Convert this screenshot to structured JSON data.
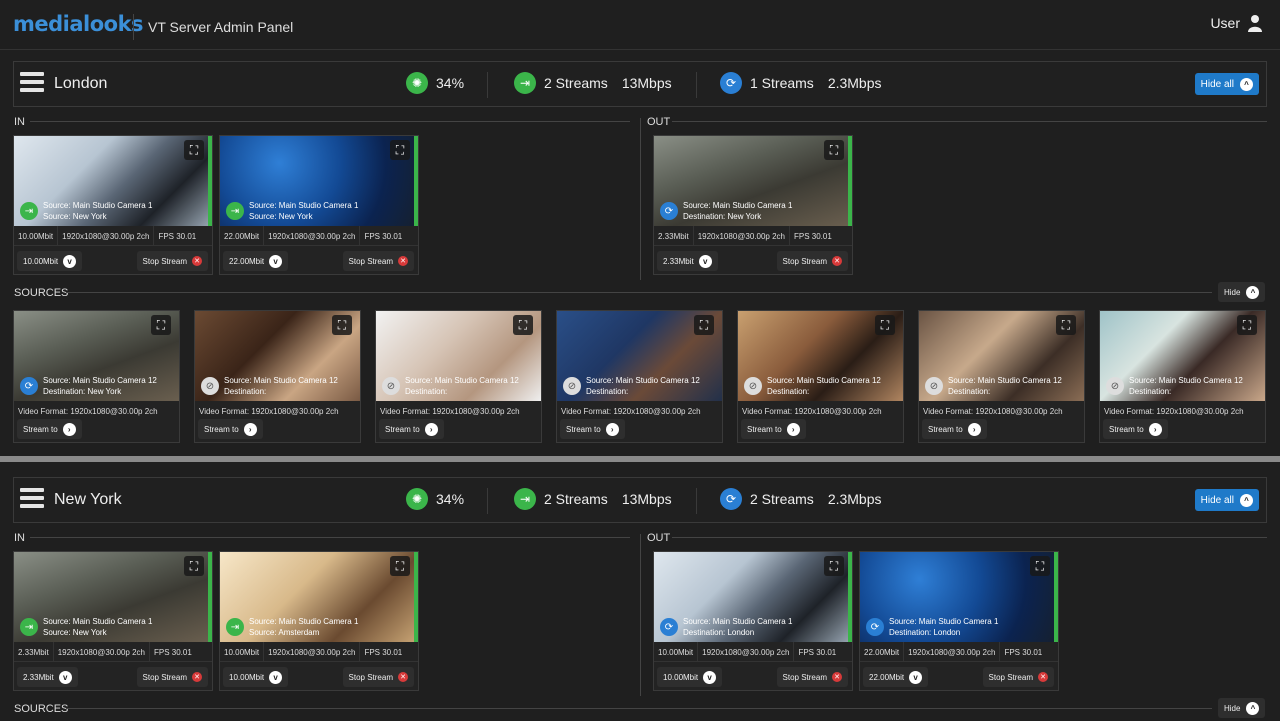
{
  "header": {
    "logo": "medialooks",
    "title": "VT Server Admin Panel",
    "user": "User"
  },
  "colors": {
    "accent": "#1f7ac9",
    "ok": "#3bb54a",
    "out": "#2a7fd4",
    "stop": "#d83a3a"
  },
  "labels": {
    "in": "IN",
    "out": "OUT",
    "sources": "SOURCES",
    "hide_all": "Hide all",
    "hide": "Hide"
  },
  "london": {
    "name": "London",
    "cpu": "34%",
    "in_streams": "2 Streams",
    "in_rate": "13Mbps",
    "out_streams": "1 Streams",
    "out_rate": "2.3Mbps",
    "in": [
      {
        "line1": "Source: Main Studio Camera 1",
        "line2": "Source: New York",
        "bitrate": "10.00Mbit",
        "format": "1920x1080@30.00p 2ch",
        "fps": "FPS 30.01",
        "sel": "10.00Mbit",
        "stop": "Stop Stream",
        "bg": "linear-gradient(135deg,#dfe7ee 0%,#b7c5d2 35%,#5a6675 55%,#1e2228 75%,#9aa8b5 100%)"
      },
      {
        "line1": "Source: Main Studio Camera 1",
        "line2": "Source: New York",
        "bitrate": "22.00Mbit",
        "format": "1920x1080@30.00p 2ch",
        "fps": "FPS 30.01",
        "sel": "22.00Mbit",
        "stop": "Stop Stream",
        "bg": "radial-gradient(circle at 30% 30%,#2f7fd6 0%,#134a95 40%,#0b2350 70%,#16202e 100%)"
      }
    ],
    "out": [
      {
        "line1": "Source: Main Studio Camera 1",
        "line2": "Destination: New York",
        "bitrate": "2.33Mbit",
        "format": "1920x1080@30.00p 2ch",
        "fps": "FPS 30.01",
        "sel": "2.33Mbit",
        "stop": "Stop Stream",
        "bg": "linear-gradient(160deg,#8a8f86 0%,#5a5e55 35%,#3b3a33 60%,#6a5f4f 100%)"
      }
    ],
    "sources": [
      {
        "line1": "Source: Main Studio Camera 12",
        "line2": "Destination: New York",
        "format": "Video Format: 1920x1080@30.00p 2ch",
        "btn": "Stream to",
        "active": true,
        "bg": "linear-gradient(160deg,#8a8f86 0%,#5a5e55 35%,#3b3a33 60%,#6a5f4f 100%)"
      },
      {
        "line1": "Source: Main Studio Camera 12",
        "line2": "Destination:",
        "format": "Video Format: 1920x1080@30.00p 2ch",
        "btn": "Stream to",
        "active": false,
        "bg": "linear-gradient(135deg,#6b4a33 0%,#3a2418 40%,#c9a583 70%,#7a5a44 100%)"
      },
      {
        "line1": "Source: Main Studio Camera 12",
        "line2": "Destination:",
        "format": "Video Format: 1920x1080@30.00p 2ch",
        "btn": "Stream to",
        "active": false,
        "bg": "linear-gradient(135deg,#f2f2f2 0%,#d6c4b5 40%,#b4967f 70%,#efefef 100%)"
      },
      {
        "line1": "Source: Main Studio Camera 12",
        "line2": "Destination:",
        "format": "Video Format: 1920x1080@30.00p 2ch",
        "btn": "Stream to",
        "active": false,
        "bg": "linear-gradient(135deg,#2a4f88 0%,#1f3764 40%,#6b4a38 65%,#22304a 100%)"
      },
      {
        "line1": "Source: Main Studio Camera 12",
        "line2": "Destination:",
        "format": "Video Format: 1920x1080@30.00p 2ch",
        "btn": "Stream to",
        "active": false,
        "bg": "linear-gradient(135deg,#c9a070 0%,#8a5c3c 40%,#2a1d16 65%,#b08560 100%)"
      },
      {
        "line1": "Source: Main Studio Camera 12",
        "line2": "Destination:",
        "format": "Video Format: 1920x1080@30.00p 2ch",
        "btn": "Stream to",
        "active": false,
        "bg": "linear-gradient(135deg,#6a5444 0%,#c7a98b 40%,#3c2e26 70%,#8a6d55 100%)"
      },
      {
        "line1": "Source: Main Studio Camera 12",
        "line2": "Destination:",
        "format": "Video Format: 1920x1080@30.00p 2ch",
        "btn": "Stream to",
        "active": false,
        "bg": "linear-gradient(135deg,#9fc3c8 0%,#d8e4e0 35%,#3a2a26 60%,#c9a78a 100%)"
      }
    ]
  },
  "newyork": {
    "name": "New York",
    "cpu": "34%",
    "in_streams": "2 Streams",
    "in_rate": "13Mbps",
    "out_streams": "2 Streams",
    "out_rate": "2.3Mbps",
    "in": [
      {
        "line1": "Source: Main Studio Camera 1",
        "line2": "Source: New York",
        "bitrate": "2.33Mbit",
        "format": "1920x1080@30.00p 2ch",
        "fps": "FPS 30.01",
        "sel": "2.33Mbit",
        "stop": "Stop Stream",
        "bg": "linear-gradient(160deg,#8a8f86 0%,#5a5e55 35%,#3b3a33 60%,#6a5f4f 100%)"
      },
      {
        "line1": "Source: Main Studio Camera 1",
        "line2": "Source: Amsterdam",
        "bitrate": "10.00Mbit",
        "format": "1920x1080@30.00p 2ch",
        "fps": "FPS 30.01",
        "sel": "10.00Mbit",
        "stop": "Stop Stream",
        "bg": "linear-gradient(135deg,#f7e7c8 0%,#d8b98a 40%,#6a4a30 70%,#c9a575 100%)"
      }
    ],
    "out": [
      {
        "line1": "Source: Main Studio Camera 1",
        "line2": "Destination: London",
        "bitrate": "10.00Mbit",
        "format": "1920x1080@30.00p 2ch",
        "fps": "FPS 30.01",
        "sel": "10.00Mbit",
        "stop": "Stop Stream",
        "bg": "linear-gradient(135deg,#dfe7ee 0%,#b7c5d2 35%,#5a6675 55%,#1e2228 75%,#9aa8b5 100%)"
      },
      {
        "line1": "Source: Main Studio Camera 1",
        "line2": "Destination: London",
        "bitrate": "22.00Mbit",
        "format": "1920x1080@30.00p 2ch",
        "fps": "FPS 30.01",
        "sel": "22.00Mbit",
        "stop": "Stop Stream",
        "bg": "radial-gradient(circle at 30% 30%,#2f7fd6 0%,#134a95 40%,#0b2350 70%,#16202e 100%)"
      }
    ]
  }
}
